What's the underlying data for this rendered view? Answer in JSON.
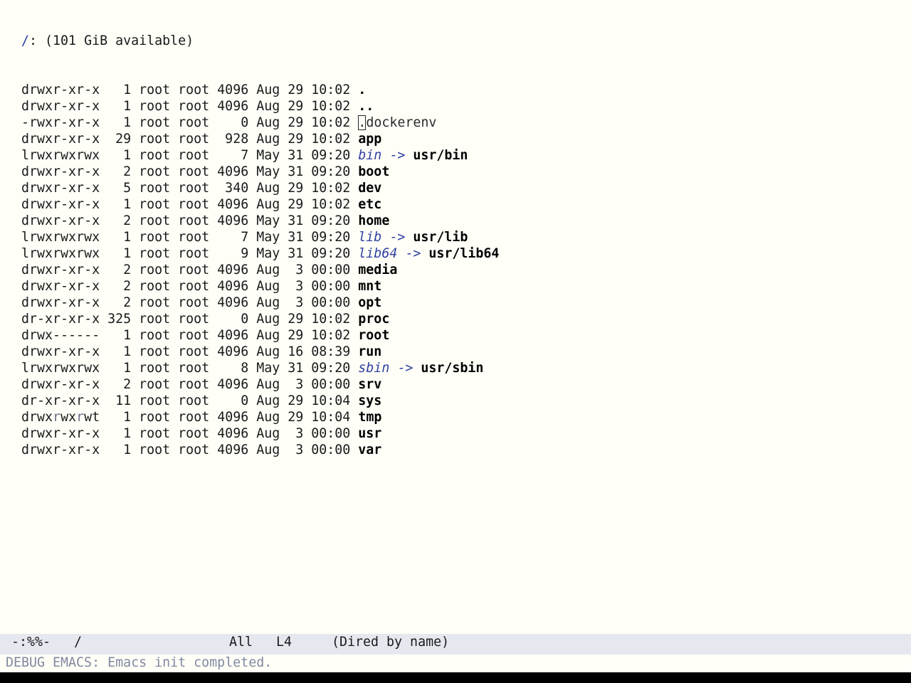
{
  "header": {
    "path": "/",
    "rest": ": (101 GiB available)"
  },
  "entries": [
    {
      "perm": "drwxr-xr-x",
      "links": "1",
      "owner": "root",
      "group": "root",
      "size": "4096",
      "date": "Aug 29 10:02",
      "name": ".",
      "kind": "dir"
    },
    {
      "perm": "drwxr-xr-x",
      "links": "1",
      "owner": "root",
      "group": "root",
      "size": "4096",
      "date": "Aug 29 10:02",
      "name": "..",
      "kind": "dir"
    },
    {
      "perm": "-rwxr-xr-x",
      "links": "1",
      "owner": "root",
      "group": "root",
      "size": "0",
      "date": "Aug 29 10:02",
      "name": ".dockerenv",
      "kind": "file",
      "cursor": true
    },
    {
      "perm": "drwxr-xr-x",
      "links": "29",
      "owner": "root",
      "group": "root",
      "size": "928",
      "date": "Aug 29 10:02",
      "name": "app",
      "kind": "dir"
    },
    {
      "perm": "lrwxrwxrwx",
      "links": "1",
      "owner": "root",
      "group": "root",
      "size": "7",
      "date": "May 31 09:20",
      "name": "bin",
      "kind": "link",
      "target": "usr/bin"
    },
    {
      "perm": "drwxr-xr-x",
      "links": "2",
      "owner": "root",
      "group": "root",
      "size": "4096",
      "date": "May 31 09:20",
      "name": "boot",
      "kind": "dir"
    },
    {
      "perm": "drwxr-xr-x",
      "links": "5",
      "owner": "root",
      "group": "root",
      "size": "340",
      "date": "Aug 29 10:02",
      "name": "dev",
      "kind": "dir"
    },
    {
      "perm": "drwxr-xr-x",
      "links": "1",
      "owner": "root",
      "group": "root",
      "size": "4096",
      "date": "Aug 29 10:02",
      "name": "etc",
      "kind": "dir"
    },
    {
      "perm": "drwxr-xr-x",
      "links": "2",
      "owner": "root",
      "group": "root",
      "size": "4096",
      "date": "May 31 09:20",
      "name": "home",
      "kind": "dir"
    },
    {
      "perm": "lrwxrwxrwx",
      "links": "1",
      "owner": "root",
      "group": "root",
      "size": "7",
      "date": "May 31 09:20",
      "name": "lib",
      "kind": "link",
      "target": "usr/lib"
    },
    {
      "perm": "lrwxrwxrwx",
      "links": "1",
      "owner": "root",
      "group": "root",
      "size": "9",
      "date": "May 31 09:20",
      "name": "lib64",
      "kind": "link",
      "target": "usr/lib64"
    },
    {
      "perm": "drwxr-xr-x",
      "links": "2",
      "owner": "root",
      "group": "root",
      "size": "4096",
      "date": "Aug  3 00:00",
      "name": "media",
      "kind": "dir"
    },
    {
      "perm": "drwxr-xr-x",
      "links": "2",
      "owner": "root",
      "group": "root",
      "size": "4096",
      "date": "Aug  3 00:00",
      "name": "mnt",
      "kind": "dir"
    },
    {
      "perm": "drwxr-xr-x",
      "links": "2",
      "owner": "root",
      "group": "root",
      "size": "4096",
      "date": "Aug  3 00:00",
      "name": "opt",
      "kind": "dir"
    },
    {
      "perm": "dr-xr-xr-x",
      "links": "325",
      "owner": "root",
      "group": "root",
      "size": "0",
      "date": "Aug 29 10:02",
      "name": "proc",
      "kind": "dir"
    },
    {
      "perm": "drwx------",
      "links": "1",
      "owner": "root",
      "group": "root",
      "size": "4096",
      "date": "Aug 29 10:02",
      "name": "root",
      "kind": "dir"
    },
    {
      "perm": "drwxr-xr-x",
      "links": "1",
      "owner": "root",
      "group": "root",
      "size": "4096",
      "date": "Aug 16 08:39",
      "name": "run",
      "kind": "dir"
    },
    {
      "perm": "lrwxrwxrwx",
      "links": "1",
      "owner": "root",
      "group": "root",
      "size": "8",
      "date": "May 31 09:20",
      "name": "sbin",
      "kind": "link",
      "target": "usr/sbin"
    },
    {
      "perm": "drwxr-xr-x",
      "links": "2",
      "owner": "root",
      "group": "root",
      "size": "4096",
      "date": "Aug  3 00:00",
      "name": "srv",
      "kind": "dir"
    },
    {
      "perm": "dr-xr-xr-x",
      "links": "11",
      "owner": "root",
      "group": "root",
      "size": "0",
      "date": "Aug 29 10:04",
      "name": "sys",
      "kind": "dir"
    },
    {
      "perm": "drwxrwxrwt",
      "links": "1",
      "owner": "root",
      "group": "root",
      "size": "4096",
      "date": "Aug 29 10:04",
      "name": "tmp",
      "kind": "dir",
      "dim_perm": true
    },
    {
      "perm": "drwxr-xr-x",
      "links": "1",
      "owner": "root",
      "group": "root",
      "size": "4096",
      "date": "Aug  3 00:00",
      "name": "usr",
      "kind": "dir"
    },
    {
      "perm": "drwxr-xr-x",
      "links": "1",
      "owner": "root",
      "group": "root",
      "size": "4096",
      "date": "Aug  3 00:00",
      "name": "var",
      "kind": "dir"
    }
  ],
  "modeline": {
    "status": "-:%%-",
    "buffer": "/",
    "position": "All",
    "line": "L4",
    "mode": "(Dired by name)"
  },
  "echo": "DEBUG EMACS: Emacs init completed.",
  "colors": {
    "background": "#fffff8",
    "modeline_bg": "#e6e8f0",
    "link": "#3040a0"
  }
}
